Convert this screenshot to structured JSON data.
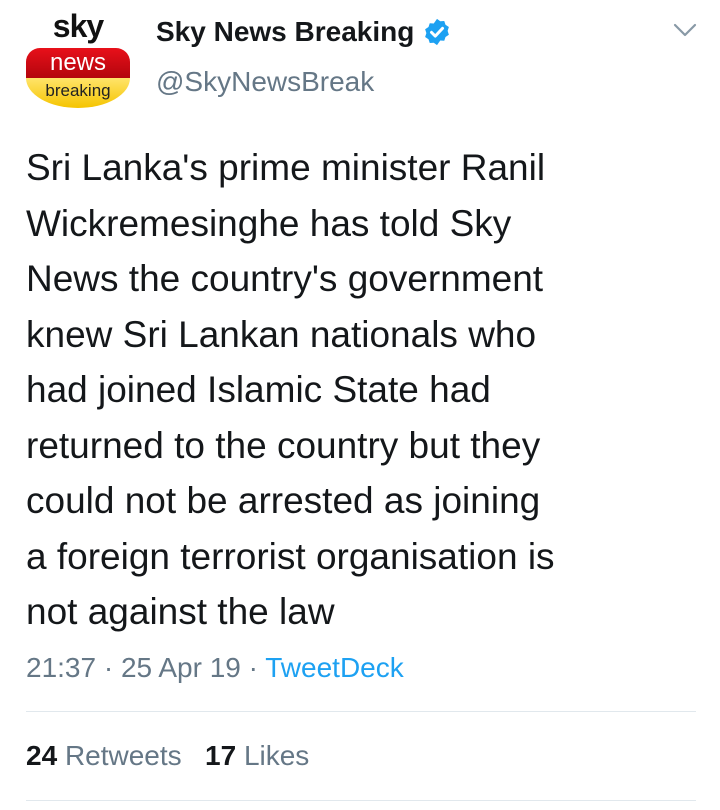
{
  "avatar": {
    "sky_text": "sky",
    "news_text": "news",
    "breaking_text": "breaking"
  },
  "user": {
    "display_name": "Sky News Breaking",
    "handle": "@SkyNewsBreak",
    "verified": true
  },
  "tweet": {
    "lines": [
      "Sri Lanka's prime minister Ranil",
      "Wickremesinghe has told Sky",
      "News the country's government",
      "knew Sri Lankan nationals who",
      "had joined Islamic State had",
      "returned to the country but they",
      "could not be arrested as joining",
      "a foreign terrorist organisation is",
      "not against the law"
    ]
  },
  "meta": {
    "time": "21:37",
    "sep1": " · ",
    "date": "25 Apr 19",
    "sep2": " · ",
    "source": "TweetDeck"
  },
  "stats": {
    "retweets_count": "24",
    "retweets_label": "Retweets",
    "likes_count": "17",
    "likes_label": "Likes"
  },
  "colors": {
    "link": "#1da1f2",
    "secondary": "#657786",
    "verified": "#1da1f2"
  },
  "icons": {
    "verified": "verified-badge-icon",
    "menu": "chevron-down-icon"
  }
}
